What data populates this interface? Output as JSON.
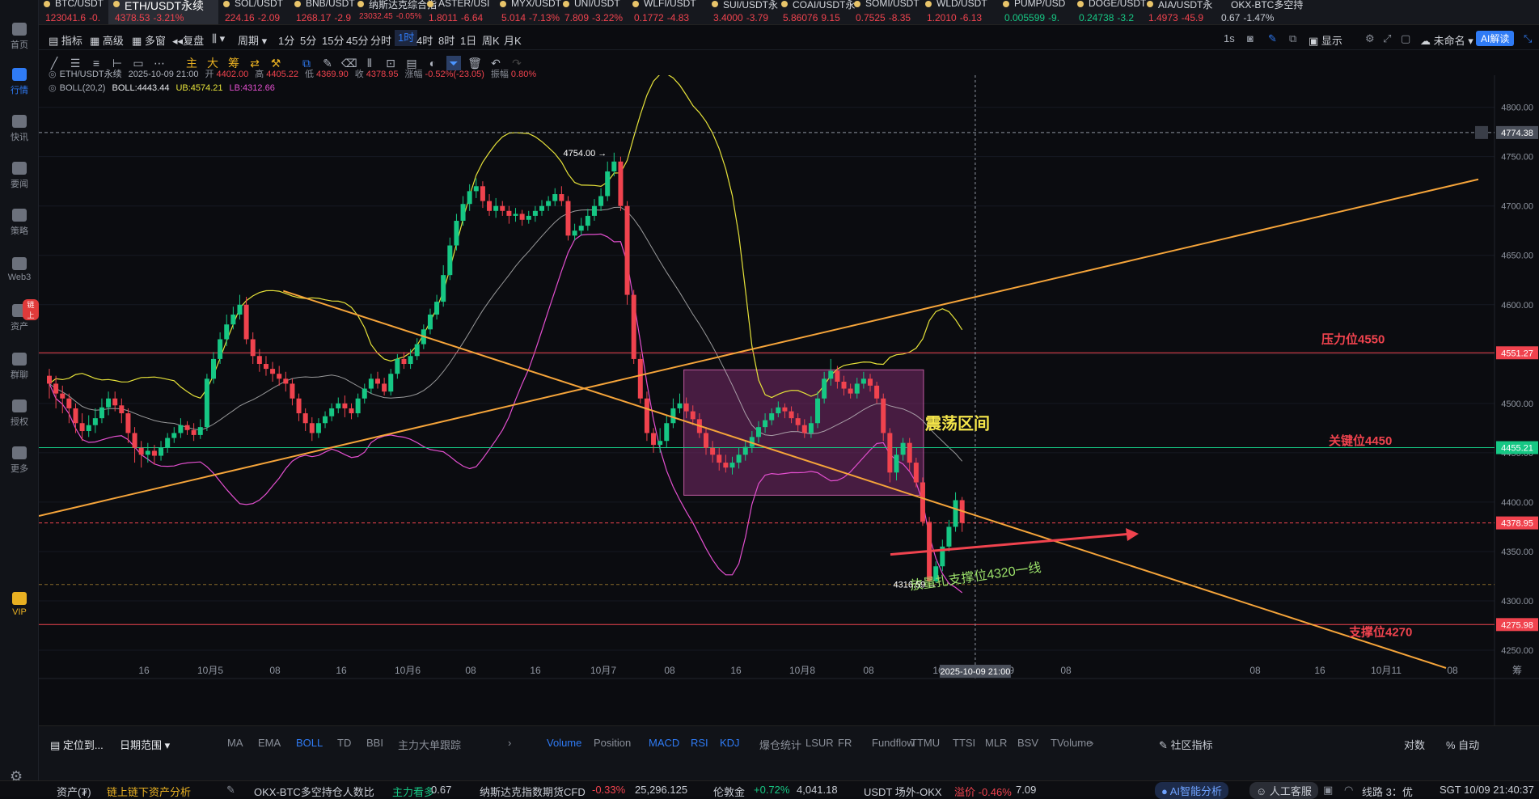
{
  "sidebar": {
    "items": [
      "首页",
      "行情",
      "快讯",
      "要闻",
      "策略",
      "Web3",
      "资产",
      "群聊",
      "授权",
      "更多",
      "VIP"
    ],
    "badge": "链上"
  },
  "ticker": [
    {
      "name": "BTC/USDT",
      "price": "123041.6",
      "change": "-0.",
      "dir": "down"
    },
    {
      "name": "ETH/USDT永续",
      "price": "4378.53",
      "change": "-3.21%",
      "dir": "down"
    },
    {
      "name": "SOL/USDT",
      "price": "224.16",
      "change": "-2.09",
      "dir": "down"
    },
    {
      "name": "BNB/USDT",
      "price": "1268.17",
      "change": "-2.9",
      "dir": "down"
    },
    {
      "name": "纳斯达克综合指",
      "price": "23032.45",
      "change": "-0.05%",
      "dir": "down"
    },
    {
      "name": "ASTER/USI",
      "price": "1.8011",
      "change": "-6.64",
      "dir": "down"
    },
    {
      "name": "MYX/USDT",
      "price": "5.014",
      "change": "-7.13%",
      "dir": "down"
    },
    {
      "name": "UNI/USDT",
      "price": "7.809",
      "change": "-3.22%",
      "dir": "down"
    },
    {
      "name": "WLFI/USDT",
      "price": "0.1772",
      "change": "-4.83",
      "dir": "down"
    },
    {
      "name": "SUI/USDT永",
      "price": "3.4000",
      "change": "-3.79",
      "dir": "down"
    },
    {
      "name": "COAI/USDT永",
      "price": "5.86076",
      "change": "9.15",
      "dir": "down"
    },
    {
      "name": "SOMI/USDT",
      "price": "0.7525",
      "change": "-8.35",
      "dir": "down"
    },
    {
      "name": "WLD/USDT",
      "price": "1.2010",
      "change": "-6.13",
      "dir": "down"
    },
    {
      "name": "PUMP/USD",
      "price": "0.005599",
      "change": "-9.",
      "dir": "up"
    },
    {
      "name": "DOGE/USDT",
      "price": "0.24738",
      "change": "-3.2",
      "dir": "up"
    },
    {
      "name": "AIA/USDT永",
      "price": "1.4973",
      "change": "-45.9",
      "dir": "down"
    },
    {
      "name": "OKX-BTC多空持",
      "price": "0.67",
      "change": "-1.47%",
      "dir": "neutral"
    }
  ],
  "toolbar": {
    "indicator": "指标",
    "advanced": "高级",
    "multi": "多窗",
    "replay": "复盘",
    "period": "周期",
    "intervals": [
      "1分",
      "5分",
      "15分",
      "45分",
      "分时",
      "1时",
      "4时",
      "8时",
      "1日",
      "周K",
      "月K"
    ],
    "active_interval": "1时",
    "right_1s": "1s",
    "display": "显示",
    "unnamed": "未命名",
    "ai": "AI解读"
  },
  "drawtools": {
    "main": "主",
    "big": "大",
    "chip": "筹"
  },
  "legend": {
    "symbol": "ETH/USDT永续",
    "time": "2025-10-09 21:00",
    "open_l": "开",
    "open": "4402.00",
    "high_l": "高",
    "high": "4405.22",
    "low_l": "低",
    "low": "4369.90",
    "close_l": "收",
    "close": "4378.95",
    "chg_l": "涨幅",
    "chg": "-0.52%(-23.05)",
    "amp_l": "振幅",
    "amp": "0.80%",
    "boll_name": "BOLL(20,2)",
    "boll": "BOLL:4443.44",
    "ub": "UB:4574.21",
    "lb": "LB:4312.66"
  },
  "colors": {
    "up": "#16c784",
    "down": "#f0434e",
    "boll_mid": "#c9c9c9",
    "boll_ub": "#e6e23a",
    "boll_lb": "#e34fcf",
    "trend": "#f5a43a",
    "box_fill": "#7a2a6a",
    "cyan": "#19c6c6"
  },
  "chart_data": {
    "type": "candlestick",
    "ylim": [
      4232,
      4830
    ],
    "y_ticks": [
      4250,
      4300,
      4350,
      4400,
      4450,
      4500,
      4550,
      4600,
      4650,
      4700,
      4750,
      4800
    ],
    "x_ticks": [
      "16",
      "10月5",
      "08",
      "16",
      "10月6",
      "08",
      "16",
      "10月7",
      "08",
      "16",
      "10月8",
      "08",
      "16",
      "10月9",
      "08",
      "16",
      "08",
      "16",
      "10月11",
      "08"
    ],
    "candles": [
      [
        4528,
        4520,
        4535,
        4505
      ],
      [
        4520,
        4510,
        4528,
        4495
      ],
      [
        4510,
        4505,
        4518,
        4490
      ],
      [
        4505,
        4495,
        4510,
        4480
      ],
      [
        4495,
        4480,
        4500,
        4470
      ],
      [
        4480,
        4472,
        4490,
        4462
      ],
      [
        4472,
        4478,
        4488,
        4466
      ],
      [
        4478,
        4485,
        4495,
        4470
      ],
      [
        4485,
        4496,
        4505,
        4480
      ],
      [
        4496,
        4505,
        4512,
        4488
      ],
      [
        4505,
        4498,
        4512,
        4492
      ],
      [
        4498,
        4490,
        4505,
        4480
      ],
      [
        4490,
        4470,
        4495,
        4460
      ],
      [
        4470,
        4455,
        4476,
        4440
      ],
      [
        4455,
        4448,
        4462,
        4435
      ],
      [
        4448,
        4452,
        4460,
        4440
      ],
      [
        4452,
        4447,
        4458,
        4438
      ],
      [
        4447,
        4455,
        4462,
        4442
      ],
      [
        4455,
        4465,
        4470,
        4450
      ],
      [
        4465,
        4470,
        4476,
        4460
      ],
      [
        4470,
        4478,
        4485,
        4465
      ],
      [
        4478,
        4473,
        4482,
        4468
      ],
      [
        4473,
        4468,
        4480,
        4462
      ],
      [
        4468,
        4476,
        4484,
        4464
      ],
      [
        4476,
        4525,
        4530,
        4472
      ],
      [
        4525,
        4545,
        4552,
        4520
      ],
      [
        4545,
        4565,
        4572,
        4540
      ],
      [
        4565,
        4580,
        4590,
        4558
      ],
      [
        4580,
        4590,
        4598,
        4575
      ],
      [
        4590,
        4600,
        4610,
        4585
      ],
      [
        4600,
        4565,
        4608,
        4560
      ],
      [
        4565,
        4548,
        4572,
        4540
      ],
      [
        4548,
        4540,
        4555,
        4532
      ],
      [
        4540,
        4535,
        4548,
        4528
      ],
      [
        4535,
        4530,
        4542,
        4522
      ],
      [
        4530,
        4525,
        4538,
        4518
      ],
      [
        4525,
        4520,
        4532,
        4512
      ],
      [
        4520,
        4505,
        4525,
        4498
      ],
      [
        4505,
        4490,
        4510,
        4482
      ],
      [
        4490,
        4480,
        4495,
        4472
      ],
      [
        4480,
        4470,
        4486,
        4462
      ],
      [
        4470,
        4480,
        4485,
        4465
      ],
      [
        4480,
        4487,
        4492,
        4475
      ],
      [
        4487,
        4495,
        4500,
        4482
      ],
      [
        4495,
        4500,
        4506,
        4490
      ],
      [
        4500,
        4495,
        4508,
        4486
      ],
      [
        4495,
        4490,
        4500,
        4484
      ],
      [
        4490,
        4505,
        4510,
        4486
      ],
      [
        4505,
        4515,
        4520,
        4500
      ],
      [
        4515,
        4525,
        4530,
        4510
      ],
      [
        4525,
        4520,
        4532,
        4515
      ],
      [
        4520,
        4512,
        4526,
        4508
      ],
      [
        4512,
        4530,
        4535,
        4508
      ],
      [
        4530,
        4545,
        4550,
        4525
      ],
      [
        4545,
        4540,
        4552,
        4535
      ],
      [
        4540,
        4548,
        4555,
        4535
      ],
      [
        4548,
        4560,
        4566,
        4544
      ],
      [
        4560,
        4575,
        4580,
        4555
      ],
      [
        4575,
        4590,
        4596,
        4570
      ],
      [
        4590,
        4603,
        4610,
        4585
      ],
      [
        4603,
        4630,
        4640,
        4598
      ],
      [
        4630,
        4660,
        4668,
        4625
      ],
      [
        4660,
        4685,
        4692,
        4655
      ],
      [
        4685,
        4702,
        4710,
        4680
      ],
      [
        4702,
        4715,
        4722,
        4695
      ],
      [
        4715,
        4720,
        4728,
        4708
      ],
      [
        4720,
        4705,
        4725,
        4698
      ],
      [
        4705,
        4695,
        4712,
        4690
      ],
      [
        4695,
        4700,
        4708,
        4688
      ],
      [
        4700,
        4695,
        4705,
        4690
      ],
      [
        4695,
        4690,
        4700,
        4682
      ],
      [
        4690,
        4692,
        4698,
        4684
      ],
      [
        4692,
        4686,
        4696,
        4680
      ],
      [
        4686,
        4690,
        4695,
        4682
      ],
      [
        4690,
        4695,
        4700,
        4684
      ],
      [
        4695,
        4700,
        4706,
        4690
      ],
      [
        4700,
        4705,
        4710,
        4695
      ],
      [
        4705,
        4712,
        4718,
        4700
      ],
      [
        4712,
        4705,
        4720,
        4700
      ],
      [
        4705,
        4670,
        4710,
        4665
      ],
      [
        4670,
        4675,
        4682,
        4665
      ],
      [
        4675,
        4680,
        4688,
        4670
      ],
      [
        4680,
        4690,
        4697,
        4675
      ],
      [
        4690,
        4700,
        4707,
        4685
      ],
      [
        4700,
        4710,
        4718,
        4695
      ],
      [
        4710,
        4735,
        4745,
        4705
      ],
      [
        4735,
        4745,
        4754,
        4730
      ],
      [
        4745,
        4700,
        4750,
        4695
      ],
      [
        4700,
        4610,
        4705,
        4600
      ],
      [
        4610,
        4545,
        4615,
        4540
      ],
      [
        4545,
        4505,
        4550,
        4500
      ],
      [
        4505,
        4470,
        4512,
        4462
      ],
      [
        4470,
        4458,
        4475,
        4450
      ],
      [
        4458,
        4462,
        4475,
        4450
      ],
      [
        4462,
        4480,
        4488,
        4455
      ],
      [
        4480,
        4495,
        4505,
        4475
      ],
      [
        4495,
        4500,
        4510,
        4490
      ],
      [
        4500,
        4492,
        4506,
        4485
      ],
      [
        4492,
        4484,
        4498,
        4478
      ],
      [
        4484,
        4470,
        4490,
        4465
      ],
      [
        4470,
        4455,
        4476,
        4448
      ],
      [
        4455,
        4448,
        4462,
        4440
      ],
      [
        4448,
        4440,
        4455,
        4432
      ],
      [
        4440,
        4435,
        4448,
        4430
      ],
      [
        4435,
        4440,
        4446,
        4428
      ],
      [
        4440,
        4448,
        4455,
        4434
      ],
      [
        4448,
        4456,
        4462,
        4442
      ],
      [
        4456,
        4466,
        4472,
        4450
      ],
      [
        4466,
        4476,
        4482,
        4460
      ],
      [
        4476,
        4483,
        4490,
        4470
      ],
      [
        4483,
        4490,
        4495,
        4478
      ],
      [
        4490,
        4496,
        4502,
        4486
      ],
      [
        4496,
        4492,
        4500,
        4485
      ],
      [
        4492,
        4485,
        4497,
        4480
      ],
      [
        4485,
        4478,
        4490,
        4472
      ],
      [
        4478,
        4470,
        4484,
        4465
      ],
      [
        4470,
        4480,
        4487,
        4465
      ],
      [
        4480,
        4505,
        4512,
        4475
      ],
      [
        4505,
        4525,
        4532,
        4500
      ],
      [
        4525,
        4533,
        4545,
        4518
      ],
      [
        4533,
        4522,
        4538,
        4515
      ],
      [
        4522,
        4515,
        4528,
        4508
      ],
      [
        4515,
        4510,
        4520,
        4505
      ],
      [
        4510,
        4520,
        4526,
        4505
      ],
      [
        4520,
        4525,
        4532,
        4515
      ],
      [
        4525,
        4518,
        4530,
        4512
      ],
      [
        4518,
        4505,
        4522,
        4500
      ],
      [
        4505,
        4470,
        4510,
        4462
      ],
      [
        4470,
        4430,
        4475,
        4420
      ],
      [
        4430,
        4448,
        4455,
        4422
      ],
      [
        4448,
        4460,
        4465,
        4442
      ],
      [
        4460,
        4440,
        4465,
        4432
      ],
      [
        4440,
        4420,
        4445,
        4415
      ],
      [
        4420,
        4380,
        4425,
        4376
      ],
      [
        4380,
        4320,
        4385,
        4316.59
      ],
      [
        4320,
        4335,
        4340,
        4318
      ],
      [
        4335,
        4355,
        4362,
        4330
      ],
      [
        4355,
        4375,
        4382,
        4350
      ],
      [
        4375,
        4402,
        4410,
        4370
      ],
      [
        4402,
        4378.95,
        4405.22,
        4369.9
      ]
    ],
    "markers": {
      "high_label": "4754.00",
      "low_label": "4316.59"
    },
    "h_levels": [
      {
        "value": 4774.38,
        "color": "#8f95a0",
        "dashed": true
      },
      {
        "value": 4551.27,
        "color": "#f0434e",
        "dashed": false
      },
      {
        "value": 4455.21,
        "color": "#16c784",
        "dashed": false
      },
      {
        "value": 4378.95,
        "color": "#f0434e",
        "dashed": true
      },
      {
        "value": 4316.59,
        "color": "#8a6a2a",
        "dashed": true
      },
      {
        "value": 4275.98,
        "color": "#f0434e",
        "dashed": false
      }
    ],
    "price_labels": [
      "4774.38",
      "4551.27",
      "4455.21",
      "4378.95",
      "4275.98"
    ],
    "annotations": {
      "resist": "压力位4550",
      "key": "关键位4450",
      "support": "支撑位4270",
      "box": "震荡区间",
      "arrow_text": "放量扎支撑位4320一线"
    },
    "crosshair_time": "2025-10-09 21:00"
  },
  "bottom": {
    "locate": "定位到...",
    "date_range": "日期范围",
    "indicators": [
      "MA",
      "EMA",
      "BOLL",
      "TD",
      "BBI",
      "主力大单跟踪"
    ],
    "sub_indicators": [
      "Volume",
      "Position",
      "MACD",
      "RSI",
      "KDJ",
      "爆仓统计",
      "LSUR",
      "FR",
      "Fundflow",
      "TTMU",
      "TTSI",
      "MLR",
      "BSV",
      "TVolume"
    ],
    "community": "社区指标",
    "compare": "对数",
    "auto": "自动",
    "intervals": [
      "1分",
      "5分",
      "15分",
      "45分",
      "分时",
      "1时",
      "4时",
      "8时",
      "1日",
      "周K",
      "月K"
    ],
    "active": "1时"
  },
  "status": {
    "assets": "资产(₮)",
    "onchain": "链上链下资产分析",
    "ratio_name": "OKX-BTC多空持仓人数比",
    "ratio_tag": "主力看多",
    "ratio_val": "0.67",
    "nasdaq_name": "纳斯达克指数期货CFD",
    "nasdaq_chg": "-0.33%",
    "nasdaq_val": "25,296.125",
    "gold_name": "伦敦金",
    "gold_chg": "+0.72%",
    "gold_val": "4,041.18",
    "usdt_name": "USDT 场外-OKX",
    "usdt_chg": "溢价 -0.46%",
    "usdt_val": "7.09",
    "ai": "AI智能分析",
    "service": "人工客服",
    "line": "线路 3：优",
    "time": "SGT 10/09 21:40:37"
  }
}
